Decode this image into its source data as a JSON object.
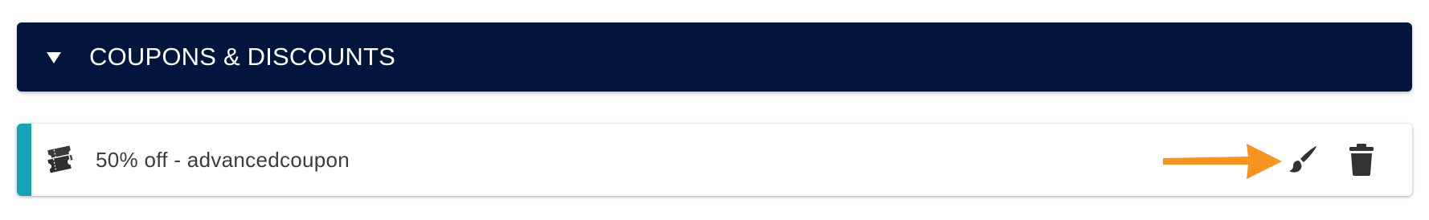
{
  "section": {
    "title": "COUPONS & DISCOUNTS",
    "toggle_icon": "caret-down-icon",
    "background_color": "#01153d",
    "text_color": "#ffffff"
  },
  "coupon": {
    "label": "50% off - advancedcoupon",
    "icon": "ticket-icon",
    "accent_color": "#13a5b5",
    "edit_icon": "paintbrush-icon",
    "delete_icon": "trash-icon"
  },
  "annotation": {
    "icon": "arrow-right-icon",
    "color": "#f7931e"
  }
}
